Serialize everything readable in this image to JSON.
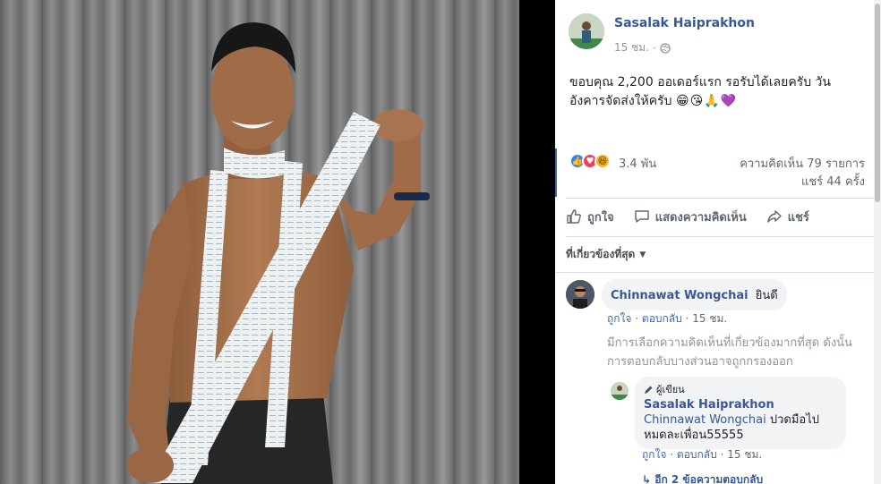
{
  "post": {
    "author": "Sasalak Haiprakhon",
    "time": "15 ชม.",
    "separator": "·",
    "privacy_icon": "globe-icon",
    "text": "ขอบคุณ 2,200 ออเดอร์แรก รอรับได้เลยครับ วันอังคารจัดส่งให้ครับ",
    "emojis": "😁😘🙏💜"
  },
  "stats": {
    "reaction_icons": [
      "like-icon",
      "love-icon",
      "haha-icon"
    ],
    "reactions": "3.4 พัน",
    "comments": "ความคิดเห็น 79 รายการ",
    "shares": "แชร์ 44 ครั้ง"
  },
  "actions": {
    "like": "ถูกใจ",
    "comment": "แสดงความคิดเห็น",
    "share": "แชร์"
  },
  "sort_label": "ที่เกี่ยวข้องที่สุด",
  "comment": {
    "author": "Chinnawat Wongchai",
    "text": "ยินดี",
    "like": "ถูกใจ",
    "reply": "ตอบกลับ",
    "time": "15 ชม.",
    "dot": "·"
  },
  "filter_note": "มีการเลือกความคิดเห็นที่เกี่ยวข้องมากที่สุด ดังนั้นการตอบกลับบางส่วนอาจถูกกรองออก",
  "reply": {
    "badge": "ผู้เขียน",
    "author": "Sasalak Haiprakhon",
    "mention": "Chinnawat Wongchai",
    "text": "ปวดมือไปหมดละเพื่อน55555",
    "like": "ถูกใจ",
    "reply": "ตอบกลับ",
    "time": "15 ชม.",
    "dot": "·"
  },
  "more_replies": "↳ อีก 2 ข้อความตอบกลับ",
  "colors": {
    "link": "#365899",
    "facebook_blue": "#4267b2",
    "meta_gray": "#90949c",
    "bubble": "#f2f3f5"
  }
}
